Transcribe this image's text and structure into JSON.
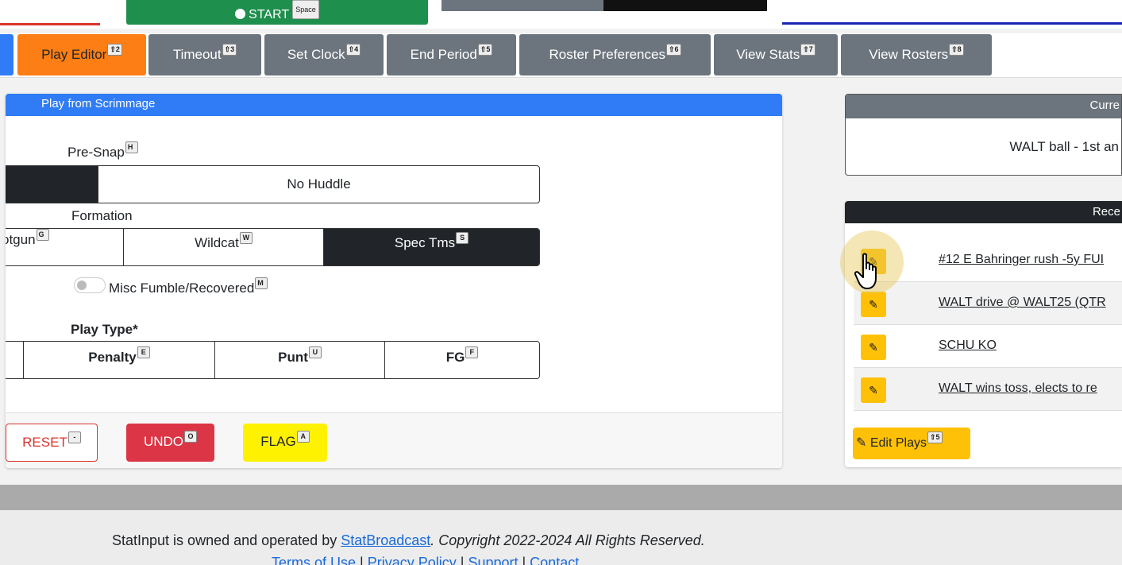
{
  "topbar": {
    "start_label": "START",
    "start_key": "Space"
  },
  "tabs": [
    {
      "label": "Play Editor",
      "key": "⇧2"
    },
    {
      "label": "Timeout",
      "key": "⇧3"
    },
    {
      "label": "Set Clock",
      "key": "⇧4"
    },
    {
      "label": "End Period",
      "key": "⇧5"
    },
    {
      "label": "Roster Preferences",
      "key": "⇧6"
    },
    {
      "label": "View Stats",
      "key": "⇧7"
    },
    {
      "label": "View Rosters",
      "key": "⇧8"
    }
  ],
  "play": {
    "header": "Play from Scrimmage",
    "presnap_label": "Pre-Snap",
    "presnap_key": "H",
    "presnap_option": "No Huddle",
    "formation_label": "Formation",
    "formations": [
      {
        "label": "otgun",
        "key": "G"
      },
      {
        "label": "Wildcat",
        "key": "W"
      },
      {
        "label": "Spec Tms",
        "key": "S"
      }
    ],
    "fumble_label": "Misc Fumble/Recovered",
    "fumble_key": "M",
    "playtype_label": "Play Type*",
    "playtypes": [
      {
        "label": "Penalty",
        "key": "E"
      },
      {
        "label": "Punt",
        "key": "U"
      },
      {
        "label": "FG",
        "key": "F"
      }
    ],
    "reset_label": "RESET",
    "reset_key": "-",
    "undo_label": "UNDO",
    "undo_key": "O",
    "flag_label": "FLAG",
    "flag_key": "A"
  },
  "current": {
    "header": "Curre",
    "status": "WALT ball - 1st an"
  },
  "recent": {
    "header": "Rece",
    "plays": [
      "#12 E Bahringer rush -5y FUI",
      "WALT drive @ WALT25 (QTR",
      "SCHU KO",
      "WALT wins toss, elects to re"
    ],
    "edit_label": "Edit Plays",
    "edit_key": "⇧5"
  },
  "footer": {
    "owned_text": "StatInput is owned and operated by",
    "brand_link": "StatBroadcast",
    "copyright": ". Copyright 2022-2024 All Rights Reserved.",
    "links": [
      "Terms of Use",
      "Privacy Policy",
      "Support",
      "Contact"
    ]
  }
}
